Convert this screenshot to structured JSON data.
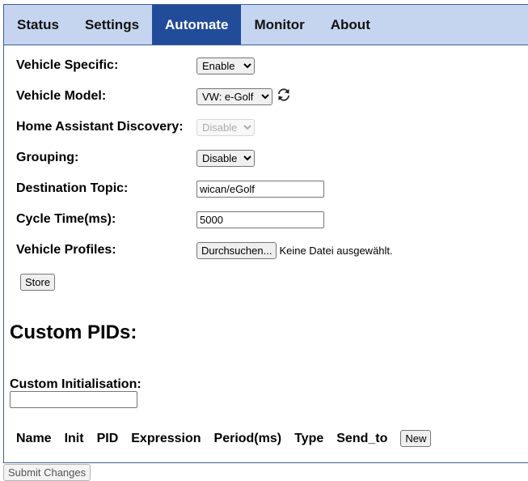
{
  "tabs": [
    {
      "label": "Status",
      "active": false
    },
    {
      "label": "Settings",
      "active": false
    },
    {
      "label": "Automate",
      "active": true
    },
    {
      "label": "Monitor",
      "active": false
    },
    {
      "label": "About",
      "active": false
    }
  ],
  "form": {
    "vehicle_specific": {
      "label": "Vehicle Specific:",
      "value": "Enable"
    },
    "vehicle_model": {
      "label": "Vehicle Model:",
      "value": "VW: e-Golf"
    },
    "ha_discovery": {
      "label": "Home Assistant Discovery:",
      "value": "Disable"
    },
    "grouping": {
      "label": "Grouping:",
      "value": "Disable"
    },
    "destination_topic": {
      "label": "Destination Topic:",
      "value": "wican/eGolf"
    },
    "cycle_time": {
      "label": "Cycle Time(ms):",
      "value": "5000"
    },
    "vehicle_profiles": {
      "label": "Vehicle Profiles:",
      "button": "Durchsuchen...",
      "status": "Keine Datei ausgewählt."
    },
    "store_label": "Store"
  },
  "custom_pids": {
    "title": "Custom PIDs:",
    "init_label": "Custom Initialisation:",
    "init_value": "",
    "columns": [
      "Name",
      "Init",
      "PID",
      "Expression",
      "Period(ms)",
      "Type",
      "Send_to"
    ],
    "new_label": "New"
  },
  "submit_label": "Submit Changes",
  "icons": {
    "refresh": "refresh-icon"
  }
}
